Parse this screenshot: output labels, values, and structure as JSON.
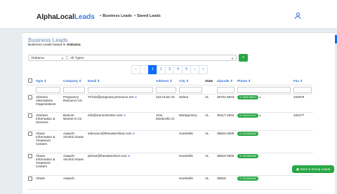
{
  "header": {
    "logo_part1": "AlphaLocal",
    "logo_part2": "Leads",
    "nav": [
      {
        "label": "Business Leads",
        "icon": "building-icon"
      },
      {
        "label": "Saved Leads",
        "icon": "bookmark-icon"
      }
    ],
    "user_icon": "user-icon"
  },
  "page": {
    "title": "Business Leads",
    "subtitle_prefix": "Business Leads based in",
    "subtitle_state": "Alabama",
    "state_select": "Alabama",
    "type_select": "All Types",
    "search_icon": "search-icon"
  },
  "pagination": [
    "«",
    "‹",
    "1",
    "2",
    "3",
    "4",
    "5",
    "›",
    "»"
  ],
  "pagination_active": "1",
  "table": {
    "columns": [
      "Type",
      "Company",
      "Email",
      "Address",
      "City",
      "State",
      "Zipcode",
      "Phone",
      "Fax"
    ],
    "rows": [
      {
        "type": "Abortion Alternatives Organizations",
        "company": "Pregnancy Resource Ctr",
        "email": "TChris@pregnancyresource.net",
        "address": "218 Union St",
        "city": "Selma",
        "state": "AL",
        "zipcode": "36701-5543",
        "phone": "3348758874",
        "fax": "334875"
      },
      {
        "type": "Abortion Information & Services",
        "company": "Beacon Women's Ctr",
        "email": "info@summitcenter.com",
        "address": "1011 Monticello Ct",
        "city": "Montgomery",
        "state": "AL",
        "zipcode": "36117-1904",
        "phone": "3342410114",
        "fax": "334277"
      },
      {
        "type": "Abuse Information & Treatment Centers",
        "company": "Aaaach-Alcohol Abuse",
        "email": "sdemarco@thewatershed.com",
        "address": "",
        "city": "Huntsville",
        "state": "AL",
        "zipcode": "35816 0000",
        "phone": "3342800066",
        "fax": ""
      },
      {
        "type": "Abuse Information & Treatment Centers",
        "company": "Aaaach-Alcohol Abuse",
        "email": "pkinse@thewatershed.com",
        "address": "",
        "city": "Huntsville",
        "state": "AL",
        "zipcode": "35816 0000",
        "phone": "3342800066",
        "fax": ""
      },
      {
        "type": "Abuse",
        "company": "Aaaach-",
        "email": "",
        "address": "",
        "city": "Huntsville",
        "state": "AL",
        "zipcode": "35816",
        "phone": "3342800066",
        "fax": ""
      }
    ]
  },
  "group_button": "Save & Group Leads",
  "colors": {
    "primary": "#0d6efd",
    "success": "#28a745",
    "brand": "#2f80ed"
  }
}
